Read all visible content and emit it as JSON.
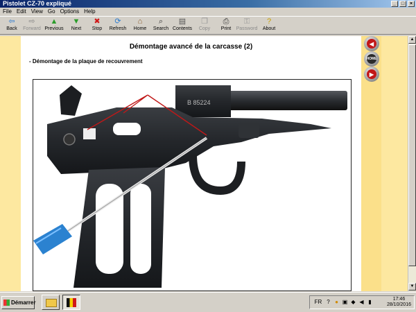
{
  "window": {
    "title": "Pistolet CZ-70 expliqué"
  },
  "menu": [
    "File",
    "Edit",
    "View",
    "Go",
    "Options",
    "Help"
  ],
  "toolbar": [
    {
      "label": "Back",
      "icon": "back-arrow-icon",
      "glyph": "⇦",
      "color": "#2a7bd0",
      "enabled": true
    },
    {
      "label": "Forward",
      "icon": "forward-arrow-icon",
      "glyph": "⇨",
      "color": "#888888",
      "enabled": false
    },
    {
      "label": "Previous",
      "icon": "up-arrow-icon",
      "glyph": "▲",
      "color": "#2a9d2a",
      "enabled": true
    },
    {
      "label": "Next",
      "icon": "down-arrow-icon",
      "glyph": "▼",
      "color": "#2a9d2a",
      "enabled": true
    },
    {
      "label": "Stop",
      "icon": "stop-icon",
      "glyph": "✖",
      "color": "#d01818",
      "enabled": true
    },
    {
      "label": "Refresh",
      "icon": "refresh-icon",
      "glyph": "⟳",
      "color": "#2a7bd0",
      "enabled": true
    },
    {
      "label": "Home",
      "icon": "home-icon",
      "glyph": "⌂",
      "color": "#8a5a2a",
      "enabled": true
    },
    {
      "label": "Search",
      "icon": "search-icon",
      "glyph": "⌕",
      "color": "#333333",
      "enabled": true
    },
    {
      "label": "Contents",
      "icon": "contents-icon",
      "glyph": "▤",
      "color": "#555555",
      "enabled": true
    },
    {
      "label": "Copy",
      "icon": "copy-icon",
      "glyph": "❐",
      "color": "#999999",
      "enabled": false
    },
    {
      "label": "Print",
      "icon": "print-icon",
      "glyph": "⎙",
      "color": "#333333",
      "enabled": true
    },
    {
      "label": "Password",
      "icon": "password-icon",
      "glyph": "⚿",
      "color": "#999999",
      "enabled": false
    },
    {
      "label": "About",
      "icon": "about-icon",
      "glyph": "?",
      "color": "#c8a000",
      "enabled": true
    }
  ],
  "page": {
    "heading": "Démontage avancé de la carcasse (2)",
    "subheading": "- Démontage de la plaque de recouvrement",
    "photo": {
      "serial": "B 85224"
    }
  },
  "nav": {
    "prev_icon": "prev-arrow-icon",
    "home_label": "HOME",
    "next_icon": "next-arrow-icon"
  },
  "taskbar": {
    "start_label": "Démarrer",
    "lang": "FR",
    "time": "17:46",
    "date": "28/10/2016"
  },
  "colors": {
    "accent_yellow": "#fbe08a",
    "titlebar": "#0a246a",
    "nav_red": "#c21818"
  }
}
